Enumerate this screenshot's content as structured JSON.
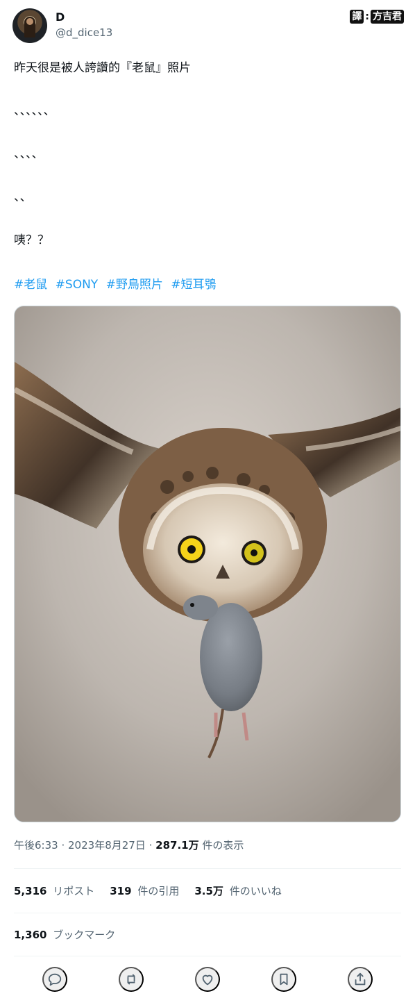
{
  "author": {
    "display_name": "D",
    "handle": "@d_dice13"
  },
  "watermark": {
    "left": "譯",
    "right": "方吉君"
  },
  "tweet": {
    "lines": [
      "昨天很是被人誇讚的『老鼠』照片",
      "、、、、、、",
      "、、、、",
      "、、",
      "咦？？"
    ],
    "hashtags": [
      "#老鼠",
      "#SONY",
      "#野鳥照片",
      "#短耳鴞"
    ]
  },
  "meta": {
    "time": "午後6:33",
    "date": "2023年8月27日",
    "views_count": "287.1万",
    "views_label": "件の表示"
  },
  "stats": {
    "reposts_count": "5,316",
    "reposts_label": "リポスト",
    "quotes_count": "319",
    "quotes_label": "件の引用",
    "likes_count": "3.5万",
    "likes_label": "件のいいね",
    "bookmarks_count": "1,360",
    "bookmarks_label": "ブックマーク"
  },
  "colors": {
    "accent": "#1d9bf0",
    "muted": "#536471",
    "text": "#0f1419"
  },
  "icons": [
    "reply-icon",
    "repost-icon",
    "like-icon",
    "bookmark-icon",
    "share-icon"
  ]
}
